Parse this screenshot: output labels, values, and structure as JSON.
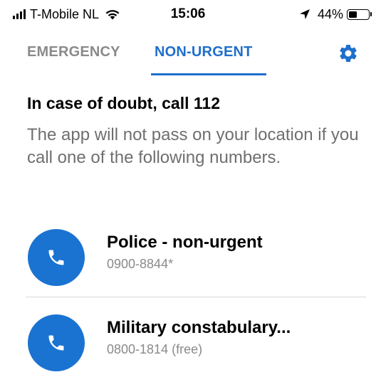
{
  "status_bar": {
    "carrier": "T-Mobile NL",
    "time": "15:06",
    "battery_percent": "44%",
    "battery_level": 0.44,
    "icons": [
      "signal-icon",
      "wifi-icon",
      "location-arrow-icon",
      "battery-icon"
    ]
  },
  "tabs": [
    {
      "label": "EMERGENCY",
      "active": false
    },
    {
      "label": "NON-URGENT",
      "active": true
    }
  ],
  "settings_icon": "gear-icon",
  "notice": {
    "title": "In case of doubt, call 112",
    "body": "The app will not pass on your location if you call one of the following numbers."
  },
  "contacts": [
    {
      "name": "Police - non-urgent",
      "number": "0900-8844*",
      "icon": "phone-icon"
    },
    {
      "name": "Military constabulary...",
      "number": "0800-1814 (free)",
      "icon": "phone-icon"
    }
  ],
  "colors": {
    "accent": "#1f6fcb",
    "call_button": "#1a73d1",
    "inactive_tab": "#8a8a8a",
    "secondary_text": "#6f6f6f",
    "divider": "#d9d9d9"
  }
}
